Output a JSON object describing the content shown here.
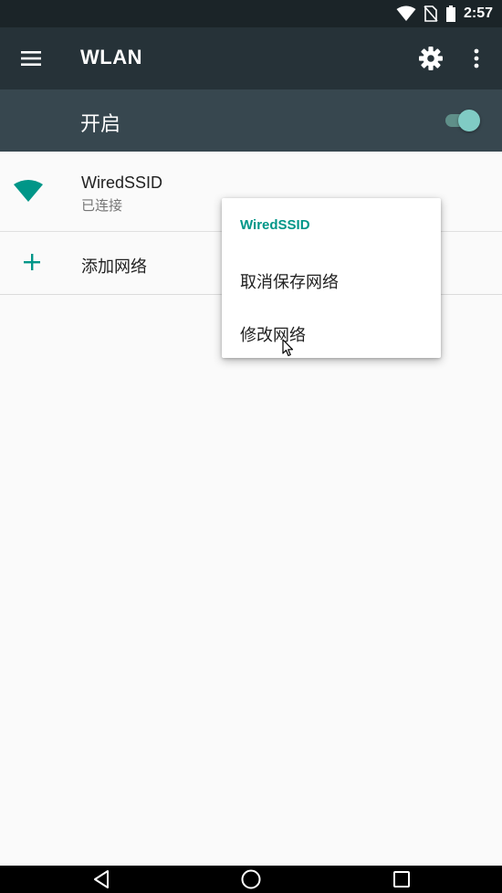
{
  "status_bar": {
    "time": "2:57",
    "icons": [
      "wifi-signal-icon",
      "no-sim-icon",
      "battery-icon"
    ]
  },
  "toolbar": {
    "title": "WLAN",
    "icons": [
      "menu-icon",
      "settings-icon",
      "overflow-menu-icon"
    ]
  },
  "master_switch": {
    "label": "开启",
    "enabled": true
  },
  "networks": [
    {
      "name": "WiredSSID",
      "status": "已连接",
      "icon": "wifi-icon"
    }
  ],
  "add_network": {
    "label": "添加网络",
    "icon": "plus-icon"
  },
  "context_menu": {
    "title": "WiredSSID",
    "items": [
      "取消保存网络",
      "修改网络"
    ]
  },
  "colors": {
    "status_bar": "#1b2428",
    "toolbar": "#263238",
    "switch_bar": "#37474f",
    "accent": "#009688",
    "background": "#fafafa"
  },
  "nav_bar": {
    "icons": [
      "back-icon",
      "home-icon",
      "recents-icon"
    ]
  }
}
